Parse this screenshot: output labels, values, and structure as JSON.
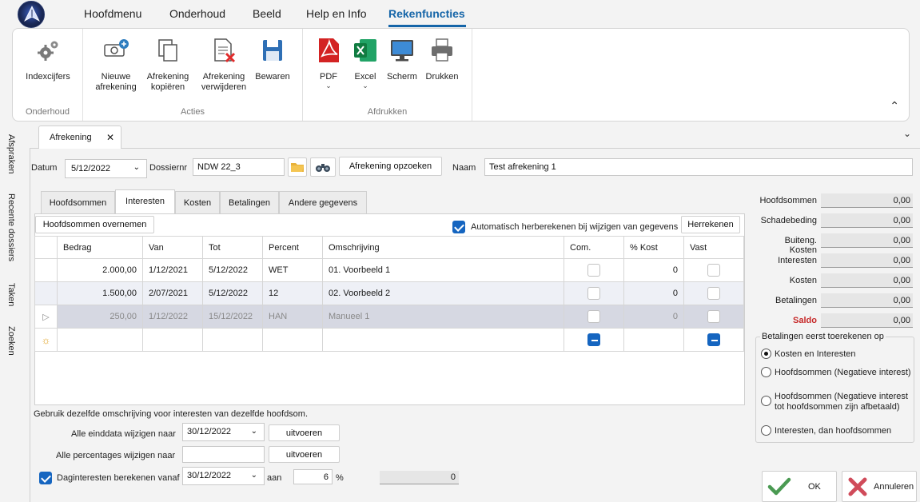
{
  "menu": {
    "items": [
      "Hoofdmenu",
      "Onderhoud",
      "Beeld",
      "Help en Info"
    ],
    "active": "Rekenfuncties"
  },
  "ribbon": {
    "groups": {
      "onderhoud": "Onderhoud",
      "acties": "Acties",
      "afdrukken": "Afdrukken"
    },
    "buttons": {
      "indexcijfers": "Indexcijfers",
      "nieuwe_l1": "Nieuwe",
      "nieuwe_l2": "afrekening",
      "kopieren_l1": "Afrekening",
      "kopieren_l2": "kopiëren",
      "verwijderen_l1": "Afrekening",
      "verwijderen_l2": "verwijderen",
      "bewaren": "Bewaren",
      "pdf": "PDF",
      "excel": "Excel",
      "scherm": "Scherm",
      "drukken": "Drukken"
    }
  },
  "sidetabs": [
    "Afspraken",
    "Recente dossiers",
    "Taken",
    "Zoeken"
  ],
  "document_tab": {
    "label": "Afrekening",
    "close": "✕"
  },
  "header": {
    "datum_label": "Datum",
    "datum_value": "5/12/2022",
    "dossiernr_label": "Dossiernr",
    "dossiernr_value": "NDW 22_3",
    "opzoeken_label": "Afrekening opzoeken",
    "naam_label": "Naam",
    "naam_value": "Test afrekening 1"
  },
  "inner_tabs": [
    "Hoofdsommen",
    "Interesten",
    "Kosten",
    "Betalingen",
    "Andere gegevens"
  ],
  "inner_active": "Interesten",
  "toolbar": {
    "overnemen": "Hoofdsommen overnemen",
    "auto_label": "Automatisch herberekenen bij wijzigen van gegevens",
    "herrekenen": "Herrekenen"
  },
  "grid": {
    "columns": [
      "Bedrag",
      "Van",
      "Tot",
      "Percent",
      "Omschrijving",
      "Com.",
      "% Kost",
      "Vast"
    ],
    "rows": [
      {
        "bedrag": "2.000,00",
        "van": "1/12/2021",
        "tot": "5/12/2022",
        "percent": "WET",
        "omschrijving": "01. Voorbeeld 1",
        "kost": "0"
      },
      {
        "bedrag": "1.500,00",
        "van": "2/07/2021",
        "tot": "5/12/2022",
        "percent": "12",
        "omschrijving": "02. Voorbeeld 2",
        "kost": "0"
      },
      {
        "bedrag": "250,00",
        "van": "1/12/2022",
        "tot": "15/12/2022",
        "percent": "HAN",
        "omschrijving": "Manueel 1",
        "kost": "0"
      }
    ],
    "row_indicator": "▷",
    "new_row_indicator": "☼"
  },
  "bottom": {
    "note": "Gebruik dezelfde omschrijving voor interesten van dezelfde hoofdsom.",
    "einddata_label": "Alle einddata wijzigen naar",
    "einddata_value": "30/12/2022",
    "uitvoeren": "uitvoeren",
    "percentages_label": "Alle percentages wijzigen naar",
    "percentages_value": "",
    "daginteresten_label": "Daginteresten berekenen vanaf",
    "daginteresten_value": "30/12/2022",
    "aan_label": "aan",
    "aan_value": "6",
    "pct": "%",
    "result": "0"
  },
  "summary": [
    {
      "label": "Hoofdsommen",
      "value": "0,00"
    },
    {
      "label": "Schadebeding",
      "value": "0,00"
    },
    {
      "label": "Buiteng. Kosten",
      "value": "0,00"
    },
    {
      "label": "Interesten",
      "value": "0,00"
    },
    {
      "label": "Kosten",
      "value": "0,00"
    },
    {
      "label": "Betalingen",
      "value": "0,00"
    },
    {
      "label": "Saldo",
      "value": "0,00"
    }
  ],
  "toerekenen": {
    "legend": "Betalingen eerst toerekenen op",
    "options": [
      "Kosten en Interesten",
      "Hoofdsommen (Negatieve interest)",
      "Hoofdsommen (Negatieve interest",
      "tot hoofdsommen zijn afbetaald)",
      "Interesten, dan hoofdsommen"
    ]
  },
  "actions": {
    "ok": "OK",
    "annuleren": "Annuleren"
  },
  "colors": {
    "accent": "#1565a8",
    "saldo": "#c62828",
    "ok_green": "#4a9a52",
    "cancel_red": "#d04b5a"
  }
}
